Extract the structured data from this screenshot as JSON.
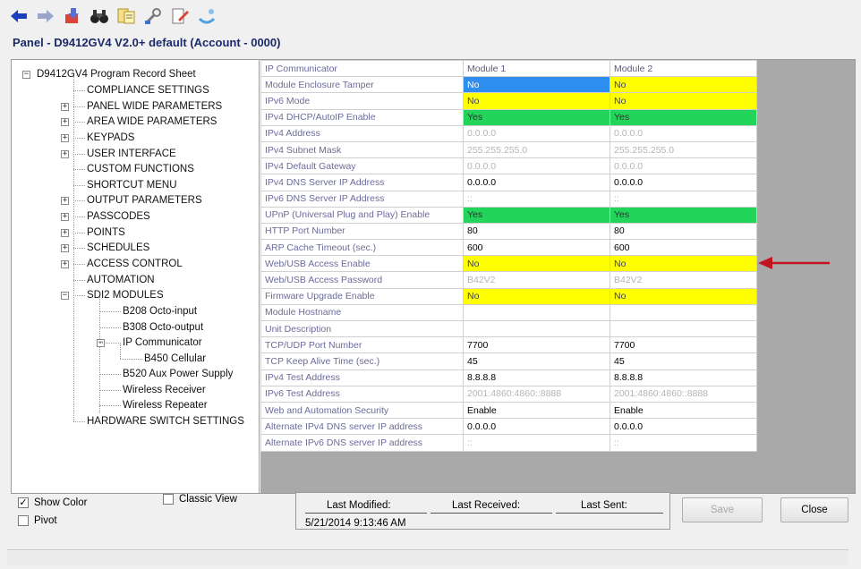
{
  "toolbar": {
    "buttons": [
      "back-icon",
      "forward-icon",
      "download-icon",
      "binoculars-icon",
      "notes-icon",
      "wrench-icon",
      "edit-document-icon",
      "connect-icon"
    ]
  },
  "panel_title": "Panel - D9412GV4 V2.0+ default (Account - 0000)",
  "tree": {
    "root": "D9412GV4 Program Record Sheet",
    "items": [
      {
        "label": "COMPLIANCE SETTINGS"
      },
      {
        "label": "PANEL WIDE PARAMETERS"
      },
      {
        "label": "AREA WIDE PARAMETERS"
      },
      {
        "label": "KEYPADS"
      },
      {
        "label": "USER INTERFACE"
      },
      {
        "label": "CUSTOM FUNCTIONS"
      },
      {
        "label": "SHORTCUT MENU"
      },
      {
        "label": "OUTPUT PARAMETERS"
      },
      {
        "label": "PASSCODES"
      },
      {
        "label": "POINTS"
      },
      {
        "label": "SCHEDULES"
      },
      {
        "label": "ACCESS CONTROL"
      },
      {
        "label": "AUTOMATION"
      },
      {
        "label": "SDI2 MODULES"
      },
      {
        "label": "B208 Octo-input"
      },
      {
        "label": "B308 Octo-output"
      },
      {
        "label": "IP Communicator"
      },
      {
        "label": "B450 Cellular"
      },
      {
        "label": "B520 Aux Power Supply"
      },
      {
        "label": "Wireless Receiver"
      },
      {
        "label": "Wireless Repeater"
      },
      {
        "label": "HARDWARE SWITCH SETTINGS"
      }
    ]
  },
  "grid": {
    "headers": [
      "IP Communicator",
      "Module 1",
      "Module 2"
    ],
    "rows": [
      {
        "label": "Module Enclosure Tamper",
        "m1": "No",
        "m2": "No",
        "c1": "blue",
        "c2": "yellow"
      },
      {
        "label": "IPv6 Mode",
        "m1": "No",
        "m2": "No",
        "c1": "yellow",
        "c2": "yellow"
      },
      {
        "label": "IPv4 DHCP/AutoIP Enable",
        "m1": "Yes",
        "m2": "Yes",
        "c1": "green",
        "c2": "green"
      },
      {
        "label": "IPv4 Address",
        "m1": "0.0.0.0",
        "m2": "0.0.0.0",
        "c1": "dim",
        "c2": "dim"
      },
      {
        "label": "IPv4 Subnet Mask",
        "m1": "255.255.255.0",
        "m2": "255.255.255.0",
        "c1": "dim",
        "c2": "dim"
      },
      {
        "label": "IPv4 Default Gateway",
        "m1": "0.0.0.0",
        "m2": "0.0.0.0",
        "c1": "dim",
        "c2": "dim"
      },
      {
        "label": "IPv4 DNS Server IP Address",
        "m1": "0.0.0.0",
        "m2": "0.0.0.0",
        "c1": "",
        "c2": ""
      },
      {
        "label": "IPv6 DNS Server IP Address",
        "m1": "::",
        "m2": "::",
        "c1": "dim",
        "c2": "dim"
      },
      {
        "label": "UPnP (Universal Plug and Play) Enable",
        "m1": "Yes",
        "m2": "Yes",
        "c1": "green",
        "c2": "green"
      },
      {
        "label": "HTTP Port Number",
        "m1": "80",
        "m2": "80",
        "c1": "",
        "c2": ""
      },
      {
        "label": "ARP Cache Timeout (sec.)",
        "m1": "600",
        "m2": "600",
        "c1": "",
        "c2": ""
      },
      {
        "label": "Web/USB Access Enable",
        "m1": "No",
        "m2": "No",
        "c1": "yellow",
        "c2": "yellow"
      },
      {
        "label": "Web/USB Access Password",
        "m1": "B42V2",
        "m2": "B42V2",
        "c1": "dim",
        "c2": "dim"
      },
      {
        "label": "Firmware Upgrade Enable",
        "m1": "No",
        "m2": "No",
        "c1": "yellow",
        "c2": "yellow"
      },
      {
        "label": "Module Hostname",
        "m1": "",
        "m2": "",
        "c1": "",
        "c2": ""
      },
      {
        "label": "Unit Description",
        "m1": "",
        "m2": "",
        "c1": "",
        "c2": ""
      },
      {
        "label": "TCP/UDP Port Number",
        "m1": "7700",
        "m2": "7700",
        "c1": "",
        "c2": ""
      },
      {
        "label": "TCP Keep Alive Time (sec.)",
        "m1": "45",
        "m2": "45",
        "c1": "",
        "c2": ""
      },
      {
        "label": "IPv4 Test Address",
        "m1": "8.8.8.8",
        "m2": "8.8.8.8",
        "c1": "",
        "c2": ""
      },
      {
        "label": "IPv6 Test Address",
        "m1": "2001:4860:4860::8888",
        "m2": "2001:4860:4860::8888",
        "c1": "dim",
        "c2": "dim"
      },
      {
        "label": "Web and Automation Security",
        "m1": "Enable",
        "m2": "Enable",
        "c1": "",
        "c2": ""
      },
      {
        "label": "Alternate IPv4 DNS server IP address",
        "m1": "0.0.0.0",
        "m2": "0.0.0.0",
        "c1": "",
        "c2": ""
      },
      {
        "label": "Alternate IPv6 DNS server IP address",
        "m1": "::",
        "m2": "::",
        "c1": "dim",
        "c2": "dim"
      }
    ]
  },
  "options": {
    "show_color": "Show Color",
    "show_color_checked": true,
    "classic_view": "Classic View",
    "classic_view_checked": false,
    "pivot": "Pivot",
    "pivot_checked": false
  },
  "status": {
    "last_modified_label": "Last Modified:",
    "last_received_label": "Last Received:",
    "last_sent_label": "Last Sent:",
    "last_modified_value": "5/21/2014 9:13:46 AM"
  },
  "buttons": {
    "save": "Save",
    "close": "Close"
  },
  "colors": {
    "blue": "#2e8ef0",
    "yellow": "#ffff00",
    "green": "#22d45a",
    "arrow": "#c0141e"
  }
}
